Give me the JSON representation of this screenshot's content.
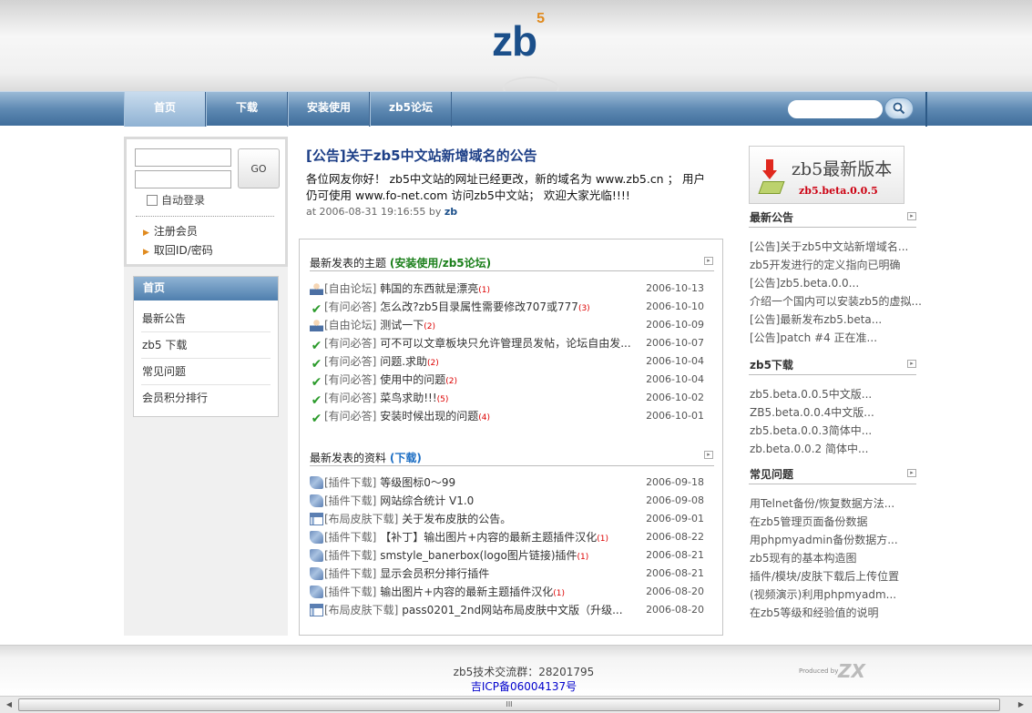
{
  "header": {
    "logo_text": "zb",
    "logo_sup": "5"
  },
  "nav": {
    "items": [
      "首页",
      "下载",
      "安装使用",
      "zb5论坛"
    ],
    "search_value": ""
  },
  "login": {
    "go_label": "GO",
    "auto_login": "自动登录",
    "register": "注册会员",
    "recover": "取回ID/密码"
  },
  "left_menu": {
    "title": "首页",
    "items": [
      "最新公告",
      "zb5 下载",
      "常见问题",
      "会员积分排行"
    ]
  },
  "announcement": {
    "title": "[公告]关于zb5中文站新增域名的公告",
    "body": "各位网友你好！ zb5中文站的网址已经更改，新的域名为 www.zb5.cn ； 用户仍可使用 www.fo-net.com 访问zb5中文站；  欢迎大家光临!!!!",
    "meta_prefix": "at 2006-08-31 19:16:55 by",
    "author": "zb"
  },
  "topics": {
    "title_prefix": "最新发表的主题",
    "title_tag": "(安装使用/zb5论坛)",
    "rows": [
      {
        "icon": "user",
        "cat": "[自由论坛]",
        "title": "韩国的东西就是漂亮",
        "count": "(1)",
        "date": "2006-10-13"
      },
      {
        "icon": "check",
        "cat": "[有问必答]",
        "title": "怎么改?zb5目录属性需要修改707或777",
        "count": "(3)",
        "date": "2006-10-10"
      },
      {
        "icon": "user",
        "cat": "[自由论坛]",
        "title": "测试一下",
        "count": "(2)",
        "date": "2006-10-09"
      },
      {
        "icon": "check",
        "cat": "[有问必答]",
        "title": "可不可以文章板块只允许管理员发帖，论坛自由发...",
        "count": "",
        "date": "2006-10-07"
      },
      {
        "icon": "check",
        "cat": "[有问必答]",
        "title": "问题.求助",
        "count": "(2)",
        "date": "2006-10-04"
      },
      {
        "icon": "check",
        "cat": "[有问必答]",
        "title": "使用中的问题",
        "count": "(2)",
        "date": "2006-10-04"
      },
      {
        "icon": "check",
        "cat": "[有问必答]",
        "title": "菜鸟求助!!!",
        "count": "(5)",
        "date": "2006-10-02"
      },
      {
        "icon": "check",
        "cat": "[有问必答]",
        "title": "安装时候出现的问题",
        "count": "(4)",
        "date": "2006-10-01"
      }
    ]
  },
  "downloads": {
    "title_prefix": "最新发表的资料",
    "title_tag": "(下载)",
    "rows": [
      {
        "icon": "plug",
        "cat": "[插件下载]",
        "title": "等级图标0～99",
        "count": "",
        "date": "2006-09-18"
      },
      {
        "icon": "plug",
        "cat": "[插件下载]",
        "title": "网站综合统计 V1.0",
        "count": "",
        "date": "2006-09-08"
      },
      {
        "icon": "win",
        "cat": "[布局皮肤下载]",
        "title": "关于发布皮肤的公告。",
        "count": "",
        "date": "2006-09-01"
      },
      {
        "icon": "plug",
        "cat": "[插件下载]",
        "title": "【补丁】输出图片+内容的最新主题插件汉化",
        "count": "(1)",
        "date": "2006-08-22"
      },
      {
        "icon": "plug",
        "cat": "[插件下载]",
        "title": "smstyle_banerbox(logo图片链接)插件",
        "count": "(1)",
        "date": "2006-08-21"
      },
      {
        "icon": "plug",
        "cat": "[插件下载]",
        "title": "显示会员积分排行插件",
        "count": "",
        "date": "2006-08-21"
      },
      {
        "icon": "plug",
        "cat": "[插件下载]",
        "title": "输出图片+内容的最新主题插件汉化",
        "count": "(1)",
        "date": "2006-08-20"
      },
      {
        "icon": "win",
        "cat": "[布局皮肤下载]",
        "title": "pass0201_2nd网站布局皮肤中文版（升级...",
        "count": "",
        "date": "2006-08-20"
      }
    ]
  },
  "right": {
    "banner_title": "zb5最新版本",
    "banner_version": "zb5.beta.0.0.5",
    "sections": [
      {
        "title": "最新公告",
        "items": [
          "[公告]关于zb5中文站新增域名...",
          "zb5开发进行的定义指向已明确",
          "[公告]zb5.beta.0.0...",
          "介绍一个国内可以安装zb5的虚拟...",
          "[公告]最新发布zb5.beta...",
          "[公告]patch #4 正在准..."
        ]
      },
      {
        "title": "zb5下载",
        "items": [
          "zb5.beta.0.0.5中文版...",
          "ZB5.beta.0.0.4中文版...",
          "zb5.beta.0.0.3简体中...",
          "zb.beta.0.0.2 简体中..."
        ]
      },
      {
        "title": "常见问题",
        "items": [
          "用Telnet备份/恢复数据方法...",
          "在zb5管理页面备份数据",
          "用phpmyadmin备份数据方...",
          "zb5现有的基本构造图",
          "插件/模块/皮肤下载后上传位置",
          "(视频演示)利用phpmyadm...",
          "在zb5等级和经验值的说明"
        ]
      }
    ]
  },
  "footer": {
    "qq": "zb5技术交流群：28201795",
    "icp": "吉ICP备06004137号",
    "produced": "Produced by",
    "zx": "ZX"
  },
  "scrollbar": {
    "thumb_label": "III"
  },
  "colors": {
    "nav_blue": "#5f8ab3",
    "title_blue": "#1d3f87",
    "tag_green": "#1a7f1a",
    "tag_blue": "#1e6fc4",
    "count_red": "#dd0000"
  }
}
